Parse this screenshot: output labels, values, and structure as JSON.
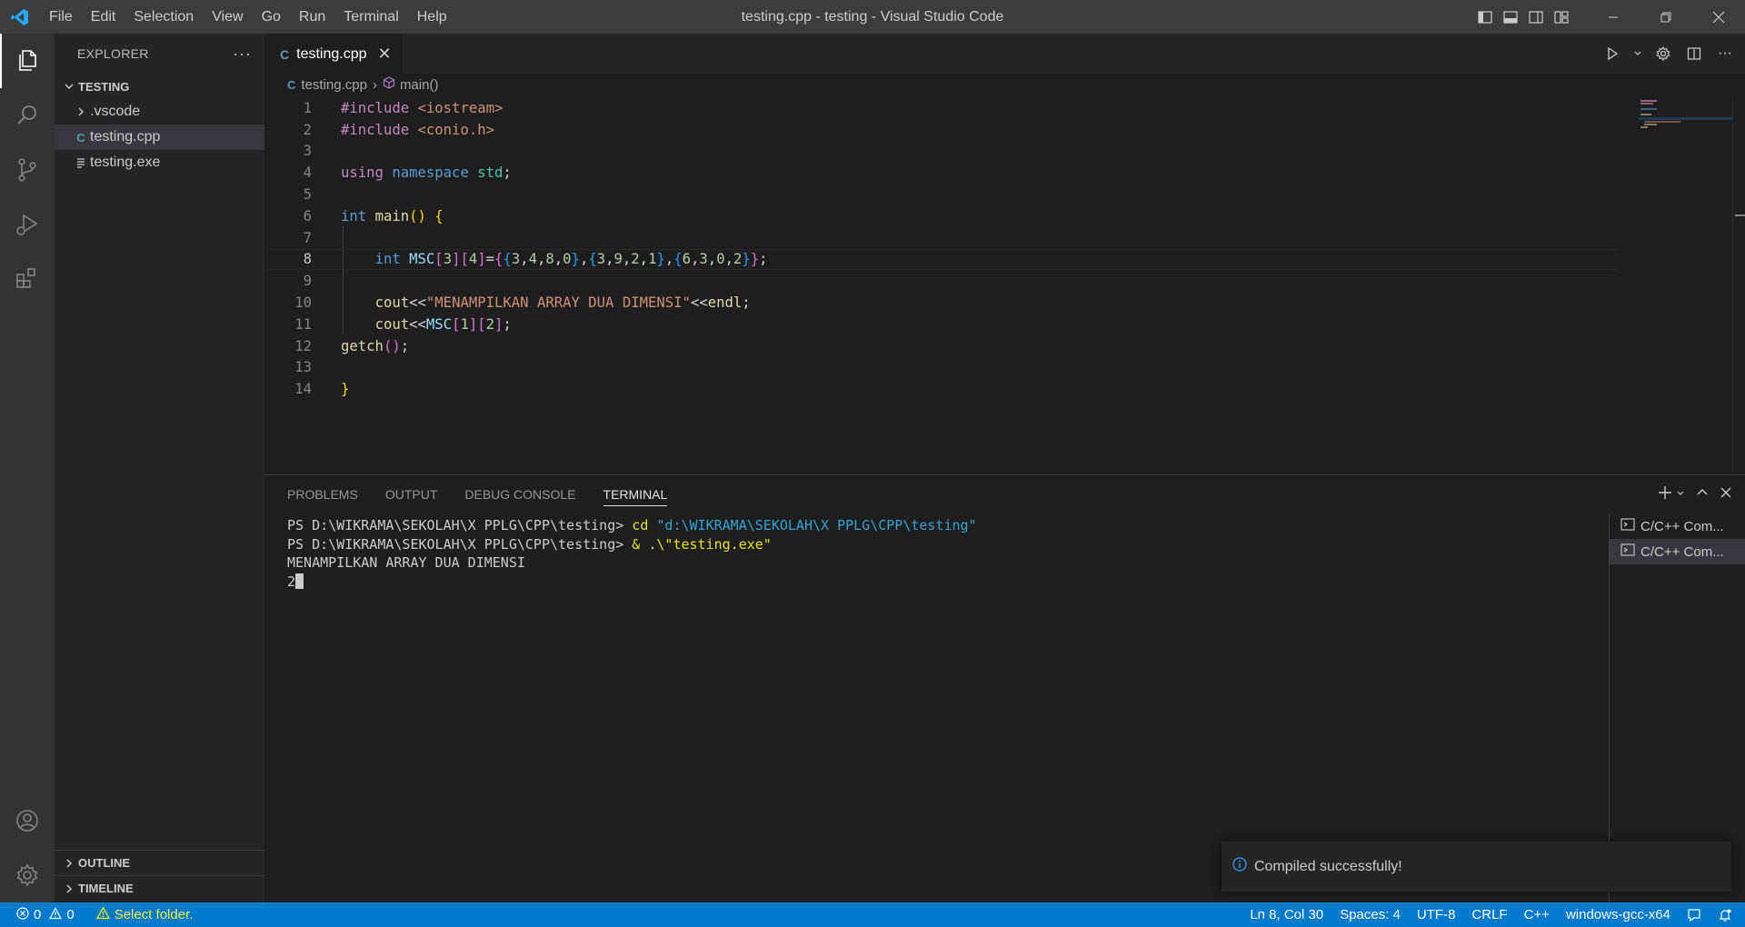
{
  "window": {
    "title": "testing.cpp - testing - Visual Studio Code",
    "menu": [
      "File",
      "Edit",
      "Selection",
      "View",
      "Go",
      "Run",
      "Terminal",
      "Help"
    ]
  },
  "activity_bar": {
    "items": [
      "explorer-icon",
      "search-icon",
      "source-control-icon",
      "run-debug-icon",
      "extensions-icon"
    ],
    "bottom": [
      "account-icon",
      "manage-gear-icon"
    ]
  },
  "sidebar": {
    "header": "EXPLORER",
    "root": "TESTING",
    "files": [
      {
        "name": ".vscode",
        "kind": "folder"
      },
      {
        "name": "testing.cpp",
        "kind": "cpp",
        "selected": true
      },
      {
        "name": "testing.exe",
        "kind": "file"
      }
    ],
    "outline": "OUTLINE",
    "timeline": "TIMELINE"
  },
  "editor": {
    "tab": "testing.cpp",
    "breadcrumb": {
      "file": "testing.cpp",
      "symbol": "main()"
    },
    "current_line": 8
  },
  "panel": {
    "tabs": [
      "PROBLEMS",
      "OUTPUT",
      "DEBUG CONSOLE",
      "TERMINAL"
    ],
    "active_tab": "TERMINAL",
    "terminal": {
      "line1": {
        "prompt": "PS D:\\WIKRAMA\\SEKOLAH\\X PPLG\\CPP\\testing> ",
        "cmd": "cd",
        "arg": " \"d:\\WIKRAMA\\SEKOLAH\\X PPLG\\CPP\\testing\""
      },
      "line2": {
        "prompt": "PS D:\\WIKRAMA\\SEKOLAH\\X PPLG\\CPP\\testing> ",
        "cmd": "& .\\\"testing.exe\""
      },
      "line3": "MENAMPILKAN ARRAY DUA DIMENSI",
      "line4": "2"
    },
    "terminals": [
      "C/C++ Com...",
      "C/C++ Com..."
    ]
  },
  "notification": {
    "message": "Compiled successfully!"
  },
  "status_bar": {
    "errors": "0",
    "warnings": "0",
    "folder_hint": "Select folder.",
    "position": "Ln 8, Col 30",
    "spaces": "Spaces: 4",
    "encoding": "UTF-8",
    "eol": "CRLF",
    "language": "C++",
    "config": "windows-gcc-x64"
  },
  "colors": {
    "accent": "#007acc",
    "activity_bar": "#333333",
    "sidebar": "#252526",
    "editor": "#1e1e1e",
    "titlebar": "#3c3c3c"
  }
}
